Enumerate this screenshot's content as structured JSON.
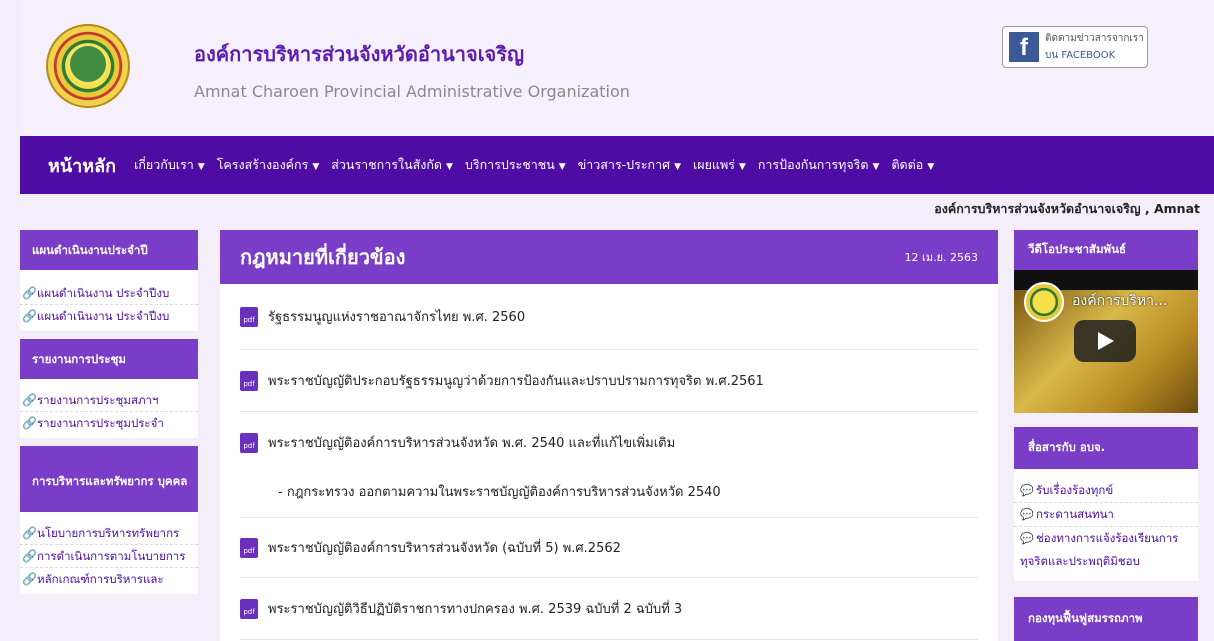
{
  "header": {
    "title_th": "องค์การบริหารส่วนจังหวัดอำนาจเจริญ",
    "title_en": "Amnat Charoen Provincial Administrative Organization",
    "facebook": {
      "line1": "ติดตามข่าวสารจากเรา",
      "line2": "บน FACEBOOK",
      "icon": "f"
    }
  },
  "nav": {
    "home": "หน้าหลัก",
    "items": [
      "เกี่ยวกับเรา",
      "โครงสร้างองค์กร",
      "ส่วนราชการในสังกัด",
      "บริการประชาชน",
      "ข่าวสาร-ประกาศ",
      "เผยแพร่",
      "การป้องกันการทุจริต",
      "ติดต่อ"
    ],
    "caret": "▼"
  },
  "marquee": "องค์การบริหารส่วนจังหวัดอำนาจเจริญ , Amnat",
  "left": {
    "sections": [
      {
        "title": "แผนดำเนินงานประจำปี",
        "links": [
          "แผนดำเนินงาน ประจำปีงบ",
          "แผนดำเนินงาน ประจำปีงบ"
        ]
      },
      {
        "title": "รายงานการประชุม",
        "links": [
          "รายงานการประชุมสภาฯ",
          "รายงานการประชุมประจำ"
        ]
      },
      {
        "title": "การบริหารและทรัพยากร บุคคล",
        "links": [
          "นโยบายการบริหารทรัพยากร",
          "การดำเนินการตามโนบายการ",
          "หลักเกณฑ์การบริหารและ"
        ]
      }
    ]
  },
  "main": {
    "title": "กฎหมายที่เกี่ยวข้อง",
    "date": "12 เม.ย. 2563",
    "pdf_label": "pdf",
    "docs": [
      "รัฐธรรมนูญแห่งราชอาณาจักรไทย พ.ศ. 2560",
      "พระราชบัญญัติประกอบรัฐธรรมนูญว่าด้วยการป้องกันและปราบปรามการทุจริต พ.ศ.2561",
      "พระราชบัญญัติองค์การบริหารส่วนจังหวัด พ.ศ. 2540 และที่แก้ไขเพิ่มเติม",
      "พระราชบัญญัติองค์การบริหารส่วนจังหวัด (ฉบับที่ 5) พ.ศ.2562",
      "พระราชบัญญัติวิธีปฏิบัติราชการทางปกครอง พ.ศ. 2539   ฉบับที่ 2   ฉบับที่ 3"
    ],
    "sub": "- กฎกระทรวง ออกตามความในพระราชบัญญัติองค์การบริหารส่วนจังหวัด 2540"
  },
  "right": {
    "video_head": "วีดีโอประชาสัมพันธ์",
    "video_title": "องค์การบริหา...",
    "contact_head": "สื่อสารกับ อบจ.",
    "contact_links": [
      "รับเรื่องร้องทุกข์",
      "กระดานสนทนา",
      "ช่องทางการแจ้งร้องเรียนการ",
      "ทุจริตและประพฤติมิชอบ"
    ],
    "fund_head": "กองทุนฟื้นฟูสมรรถภาพ"
  },
  "colors": {
    "brand_purple": "#4e0ca5",
    "header_purple": "#7a3dc7",
    "facebook_blue": "#3b5998"
  }
}
